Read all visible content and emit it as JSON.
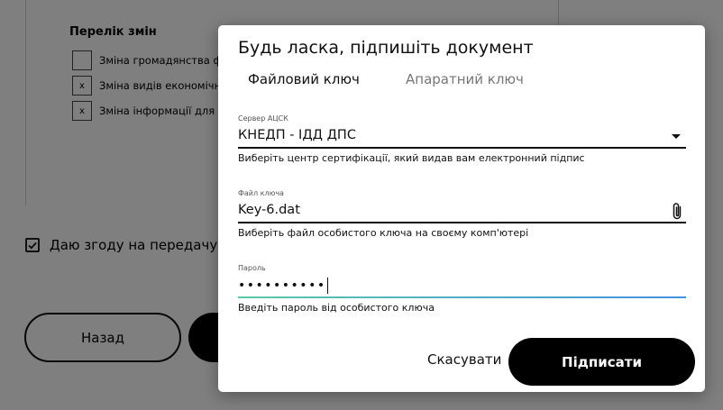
{
  "background": {
    "changes_title": "Перелік змін",
    "changes": [
      {
        "checked": false,
        "mark": "",
        "label": "Зміна громадянства ф"
      },
      {
        "checked": true,
        "mark": "x",
        "label": "Зміна видів економічн"
      },
      {
        "checked": true,
        "mark": "x",
        "label": "Зміна інформації для"
      }
    ],
    "consent_label": "Даю згоду на передачу т",
    "consent_checked": true,
    "back_button": "Назад"
  },
  "modal": {
    "title": "Будь ласка, підпишіть документ",
    "tabs": [
      {
        "label": "Файловий ключ",
        "active": true
      },
      {
        "label": "Апаратний ключ",
        "active": false
      }
    ],
    "fields": {
      "server": {
        "label": "Сервер АЦСК",
        "value": "КНЕДП - ІДД ДПС",
        "helper": "Виберіть центр сертифікації, який видав вам електронний підпис"
      },
      "key_file": {
        "label": "Файл ключа",
        "value": "Key-6.dat",
        "helper": "Виберіть файл особистого ключа на своєму комп'ютері"
      },
      "password": {
        "label": "Пароль",
        "value": "••••••••••",
        "helper": "Введіть пароль від особистого ключа"
      }
    },
    "cancel_button": "Скасувати",
    "sign_button": "Підписати"
  },
  "colors": {
    "overlay": "#808080",
    "primary_button": "#000000",
    "password_focus_start": "#5ccaa8",
    "password_focus_end": "#4a90e2",
    "inactive_tab": "#777777"
  },
  "icons": {
    "server_dropdown": "chevron-down-icon",
    "key_file_attach": "paperclip-icon",
    "consent_check": "checkmark-icon"
  }
}
